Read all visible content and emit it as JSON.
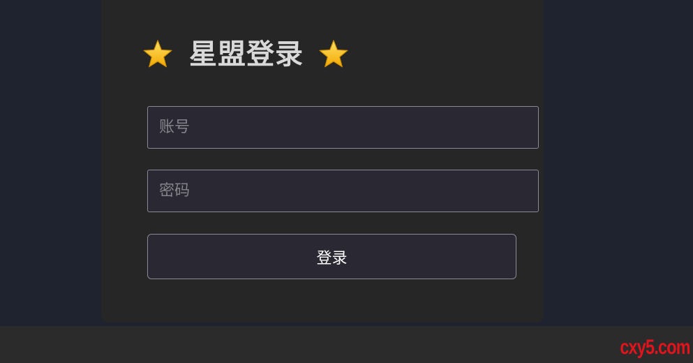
{
  "login": {
    "title": "星盟登录",
    "account_placeholder": "账号",
    "password_placeholder": "密码",
    "submit_label": "登录",
    "decorations": [
      "star-icon",
      "star-icon"
    ]
  },
  "watermark": {
    "text": "cxy5.com",
    "color": "#e0141c"
  },
  "colors": {
    "page_background": "#1f222f",
    "card_background": "#262626",
    "field_background": "#2a2833",
    "star": "#f5c518"
  }
}
